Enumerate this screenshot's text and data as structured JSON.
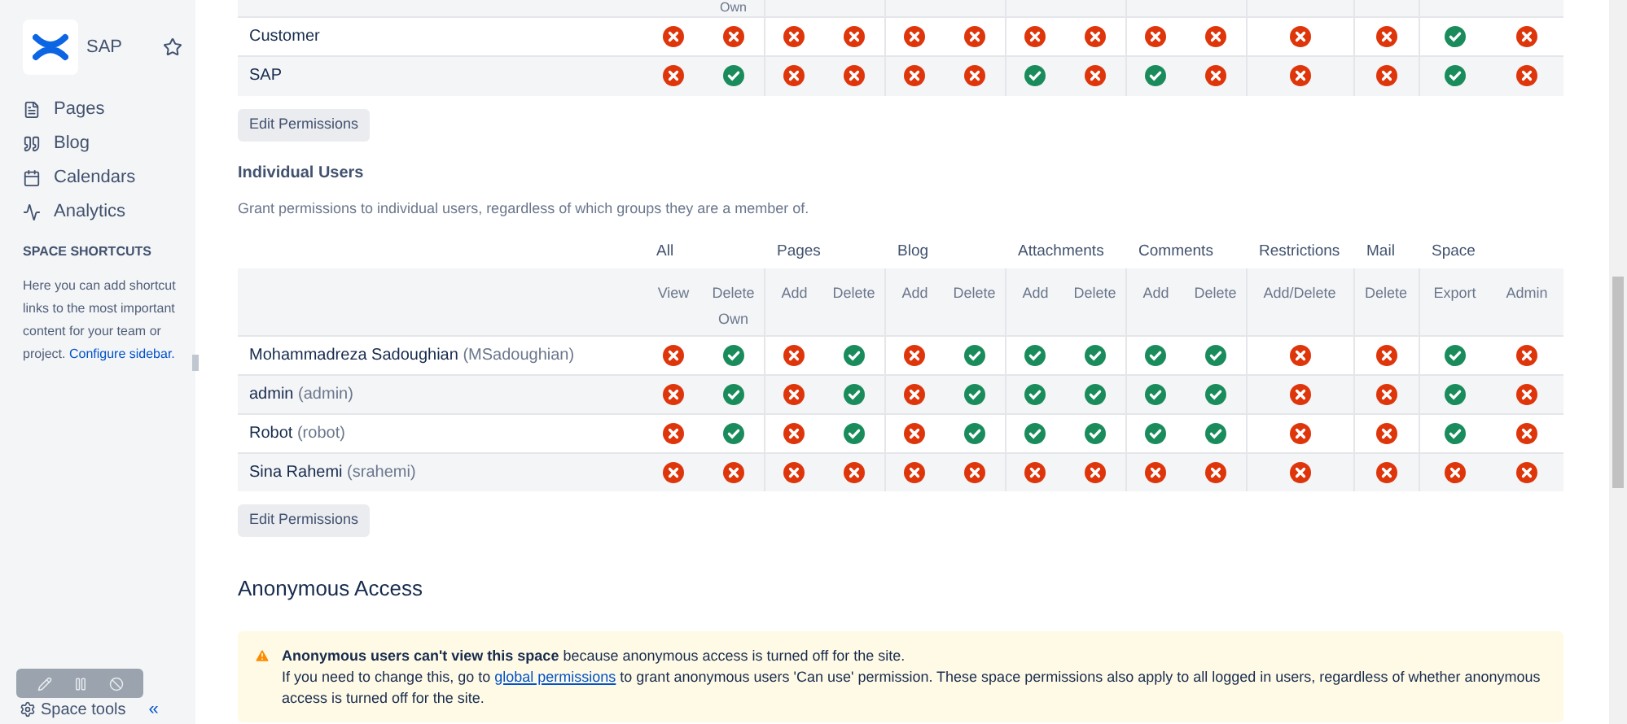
{
  "sidebar": {
    "space_name": "SAP",
    "nav": [
      {
        "label": "Pages",
        "kind": "pages"
      },
      {
        "label": "Blog",
        "kind": "blog"
      },
      {
        "label": "Calendars",
        "kind": "calendars"
      },
      {
        "label": "Analytics",
        "kind": "analytics"
      }
    ],
    "shortcuts_heading": "SPACE SHORTCUTS",
    "shortcuts_text": "Here you can add shortcut links to the most important content for your team or project.",
    "configure_link": "Configure sidebar.",
    "space_tools": "Space tools",
    "collapse": "«"
  },
  "group_table": {
    "header_fragment": "Own",
    "rows": [
      {
        "name": "Customer",
        "permissions": [
          false,
          false,
          false,
          false,
          false,
          false,
          false,
          false,
          false,
          false,
          false,
          false,
          true,
          false
        ]
      },
      {
        "name": "SAP",
        "permissions": [
          false,
          true,
          false,
          false,
          false,
          false,
          true,
          false,
          true,
          false,
          false,
          false,
          true,
          false
        ]
      }
    ],
    "button": "Edit Permissions"
  },
  "individual_users": {
    "heading": "Individual Users",
    "description": "Grant permissions to individual users, regardless of which groups they are a member of.",
    "columns": [
      {
        "group": "All",
        "permissions": [
          "View",
          "Delete Own"
        ]
      },
      {
        "group": "Pages",
        "permissions": [
          "Add",
          "Delete"
        ]
      },
      {
        "group": "Blog",
        "permissions": [
          "Add",
          "Delete"
        ]
      },
      {
        "group": "Attachments",
        "permissions": [
          "Add",
          "Delete"
        ]
      },
      {
        "group": "Comments",
        "permissions": [
          "Add",
          "Delete"
        ]
      },
      {
        "group": "Restrictions",
        "permissions": [
          "Add/Delete"
        ]
      },
      {
        "group": "Mail",
        "permissions": [
          "Delete"
        ]
      },
      {
        "group": "Space",
        "permissions": [
          "Export",
          "Admin"
        ]
      }
    ],
    "rows": [
      {
        "name": "Mohammadreza Sadoughian",
        "username": "(MSadoughian)",
        "permissions": [
          false,
          true,
          false,
          true,
          false,
          true,
          true,
          true,
          true,
          true,
          false,
          false,
          true,
          false
        ]
      },
      {
        "name": "admin",
        "username": "(admin)",
        "permissions": [
          false,
          true,
          false,
          true,
          false,
          true,
          true,
          true,
          true,
          true,
          false,
          false,
          true,
          false
        ]
      },
      {
        "name": "Robot",
        "username": "(robot)",
        "permissions": [
          false,
          true,
          false,
          true,
          false,
          true,
          true,
          true,
          true,
          true,
          false,
          false,
          true,
          false
        ]
      },
      {
        "name": "Sina Rahemi",
        "username": "(srahemi)",
        "permissions": [
          false,
          false,
          false,
          false,
          false,
          false,
          false,
          false,
          false,
          false,
          false,
          false,
          false,
          false
        ]
      }
    ],
    "button": "Edit Permissions"
  },
  "anonymous_access": {
    "heading": "Anonymous Access",
    "warning": "**Anonymous users can't view this space** because anonymous access is turned off for the site.",
    "detail_before": "If you need to change this, go to",
    "link": "global permissions",
    "detail_after": "to grant anonymous users 'Can use' permission. These space permissions also apply to all logged in users, regardless of whether anonymous access is turned off for the site."
  }
}
